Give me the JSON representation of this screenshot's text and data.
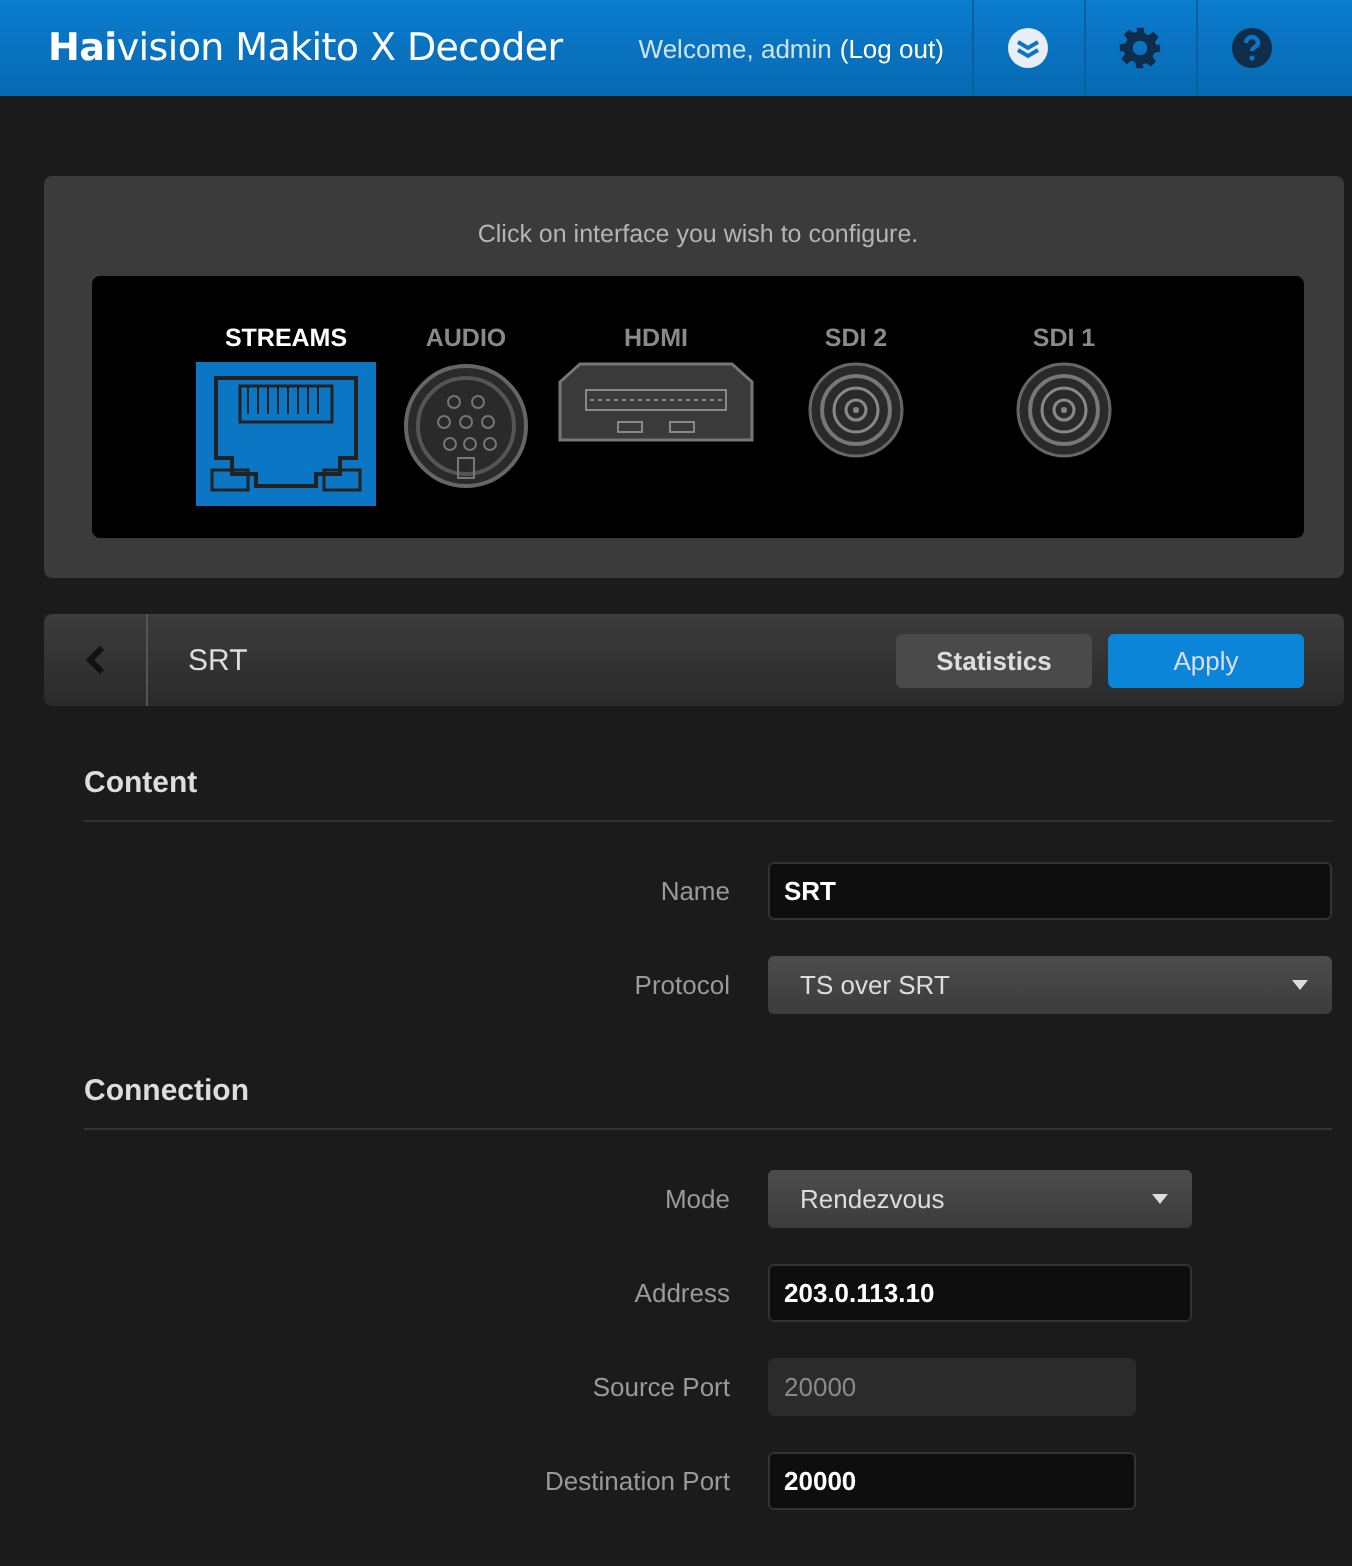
{
  "header": {
    "brand": "**Hai**vision Makito X Decoder",
    "welcome": "Welcome, admin",
    "logout": "(Log out)"
  },
  "interfaces": {
    "prompt": "Click on interface you wish to configure.",
    "items": [
      {
        "label": "STREAMS",
        "kind": "ethernet",
        "selected": true
      },
      {
        "label": "AUDIO",
        "kind": "audio",
        "selected": false
      },
      {
        "label": "HDMI",
        "kind": "hdmi",
        "selected": false
      },
      {
        "label": "SDI 2",
        "kind": "bnc",
        "selected": false
      },
      {
        "label": "SDI 1",
        "kind": "bnc",
        "selected": false
      }
    ]
  },
  "toolbar": {
    "title": "SRT",
    "buttons": [
      {
        "label": "Statistics",
        "kind": "secondary"
      },
      {
        "label": "Apply",
        "kind": "primary"
      }
    ]
  },
  "sections": [
    {
      "title": "Content",
      "fields": [
        {
          "label": "Name",
          "kind": "text",
          "value": "SRT",
          "disabled": false
        },
        {
          "label": "Protocol",
          "kind": "select",
          "value": "TS over SRT",
          "disabled": false
        }
      ]
    },
    {
      "title": "Connection",
      "fields": [
        {
          "label": "Mode",
          "kind": "select",
          "value": "Rendezvous",
          "disabled": false
        },
        {
          "label": "Address",
          "kind": "text",
          "value": "203.0.113.10",
          "disabled": false
        },
        {
          "label": "Source Port",
          "kind": "text",
          "value": "20000",
          "disabled": true
        },
        {
          "label": "Destination Port",
          "kind": "text",
          "value": "20000",
          "disabled": false
        }
      ]
    }
  ]
}
